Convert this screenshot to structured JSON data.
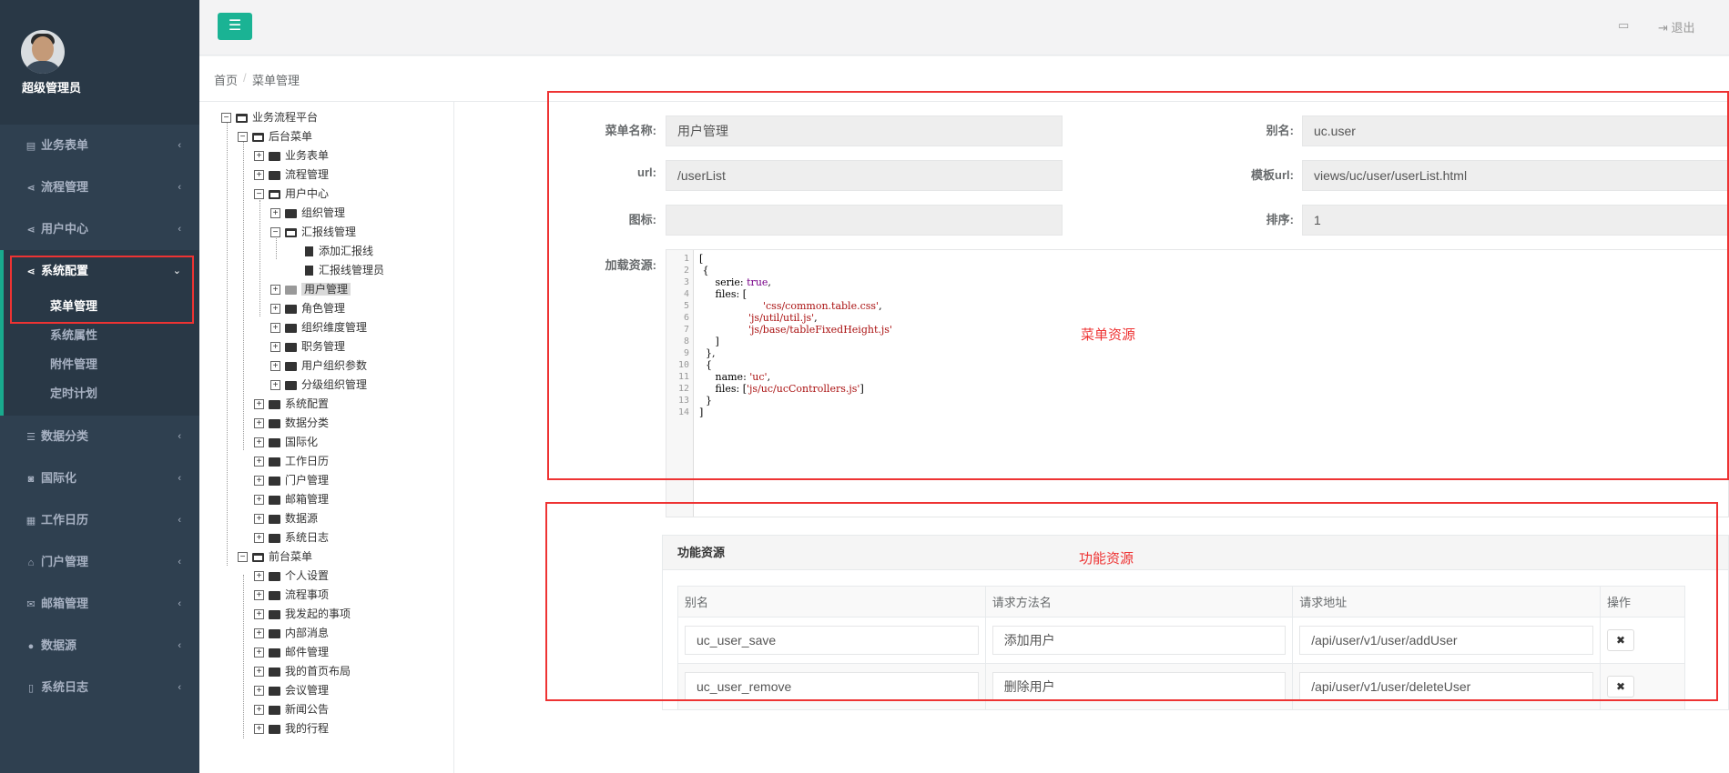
{
  "profile": {
    "name": "超级管理员"
  },
  "nav": {
    "items": [
      {
        "label": "业务表单",
        "icon": "list-icon"
      },
      {
        "label": "流程管理",
        "icon": "share-icon"
      },
      {
        "label": "用户中心",
        "icon": "share-icon"
      },
      {
        "label": "系统配置",
        "icon": "share-icon"
      },
      {
        "label": "数据分类",
        "icon": "database-icon"
      },
      {
        "label": "国际化",
        "icon": "globe-icon"
      },
      {
        "label": "工作日历",
        "icon": "calendar-icon"
      },
      {
        "label": "门户管理",
        "icon": "home-icon"
      },
      {
        "label": "邮箱管理",
        "icon": "envelope-icon"
      },
      {
        "label": "数据源",
        "icon": "circle-icon"
      },
      {
        "label": "系统日志",
        "icon": "file-icon"
      }
    ],
    "sub": [
      "菜单管理",
      "系统属性",
      "附件管理",
      "定时计划"
    ]
  },
  "topbar": {
    "logout": "退出"
  },
  "breadcrumb": {
    "home": "首页",
    "sep": "/",
    "current": "菜单管理"
  },
  "tree": {
    "root": "业务流程平台",
    "backend": "后台菜单",
    "n1": "业务表单",
    "n2": "流程管理",
    "n3": "用户中心",
    "n3a": "组织管理",
    "n3b": "汇报线管理",
    "n3b1": "添加汇报线",
    "n3b2": "汇报线管理员",
    "n3c": "用户管理",
    "n3d": "角色管理",
    "n3e": "组织维度管理",
    "n3f": "职务管理",
    "n3g": "用户组织参数",
    "n3h": "分级组织管理",
    "n4": "系统配置",
    "n5": "数据分类",
    "n6": "国际化",
    "n7": "工作日历",
    "n8": "门户管理",
    "n9": "邮箱管理",
    "n10": "数据源",
    "n11": "系统日志",
    "frontend": "前台菜单",
    "f1": "个人设置",
    "f2": "流程事项",
    "f3": "我发起的事项",
    "f4": "内部消息",
    "f5": "邮件管理",
    "f6": "我的首页布局",
    "f7": "会议管理",
    "f8": "新闻公告",
    "f9": "我的行程"
  },
  "form": {
    "name_label": "菜单名称:",
    "name_value": "用户管理",
    "alias_label": "别名:",
    "alias_value": "uc.user",
    "url_label": "url:",
    "url_value": "/userList",
    "tpl_label": "模板url:",
    "tpl_value": "views/uc/user/userList.html",
    "icon_label": "图标:",
    "icon_value": "",
    "order_label": "排序:",
    "order_value": "1",
    "res_label": "加载资源:"
  },
  "code": {
    "lines": [
      "1",
      "2",
      "3",
      "4",
      "5",
      "6",
      "7",
      "8",
      "9",
      "10",
      "11",
      "12",
      "13",
      "14"
    ],
    "l1": "[",
    "l2": " {",
    "l3a": "     serie: ",
    "l3b": "true",
    "l3c": ",",
    "l4": "     files: [",
    "l5": "'css/common.table.css'",
    "l5c": ",",
    "l6": "'js/util/util.js'",
    "l6c": ",",
    "l7": "'js/base/tableFixedHeight.js'",
    "l8": "     ]",
    "l9": "  },",
    "l10": "  {",
    "l11a": "     name: ",
    "l11b": "'uc'",
    "l11c": ",",
    "l12a": "     files: [",
    "l12b": "'js/uc/ucControllers.js'",
    "l12c": "]",
    "l13": "  }",
    "l14": "]"
  },
  "annotations": {
    "menu_res": "菜单资源",
    "func_res": "功能资源"
  },
  "funcpanel": {
    "title": "功能资源",
    "headers": [
      "别名",
      "请求方法名",
      "请求地址",
      "操作"
    ],
    "rows": [
      {
        "alias": "uc_user_save",
        "method": "添加用户",
        "url": "/api/user/v1/user/addUser",
        "del": "✖"
      },
      {
        "alias": "uc_user_remove",
        "method": "删除用户",
        "url": "/api/user/v1/user/deleteUser",
        "del": "✖"
      }
    ]
  },
  "colors": {
    "sidebar": "#2f4050",
    "accent": "#1ab394",
    "highlight": "#e33333"
  }
}
